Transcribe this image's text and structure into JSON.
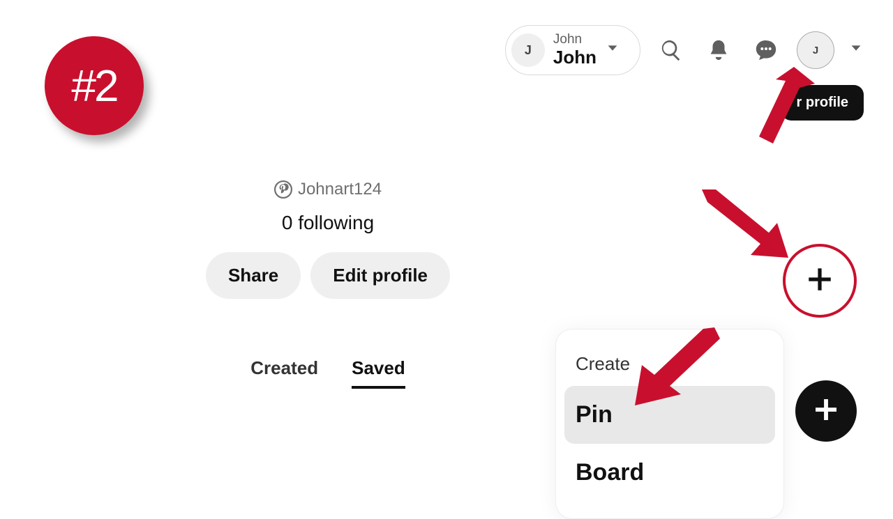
{
  "annotation": {
    "badge": "#2"
  },
  "header": {
    "account": {
      "avatar_initial": "J",
      "name_small": "John",
      "name_big": "John"
    },
    "profile_avatar_initial": "J"
  },
  "tooltip": {
    "text": "r profile"
  },
  "profile": {
    "username": "Johnart124",
    "following_text": "0 following",
    "share_label": "Share",
    "edit_label": "Edit profile",
    "tabs": {
      "created": "Created",
      "saved": "Saved",
      "active": "saved"
    }
  },
  "create_menu": {
    "header": "Create",
    "options": [
      {
        "label": "Pin",
        "selected": true
      },
      {
        "label": "Board",
        "selected": false
      }
    ]
  }
}
